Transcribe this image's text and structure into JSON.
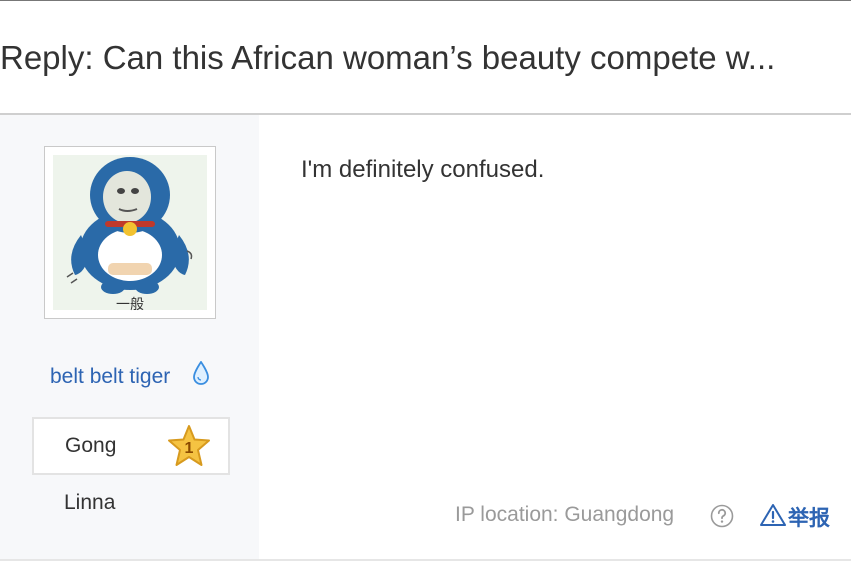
{
  "post": {
    "title": "Reply: Can this African woman’s beauty compete w...",
    "content": "I'm definitely confused."
  },
  "author": {
    "avatar_caption": "一般",
    "username": "belt belt tiger",
    "username_icon": "water-drop-icon",
    "level_name": "Gong",
    "level_number": "1",
    "level_icon": "star-badge-icon",
    "sub_name": "Linna"
  },
  "footer": {
    "ip_location": "IP location: Guangdong",
    "help_icon": "question-circle-icon",
    "report_label": "举报",
    "report_icon": "warning-triangle-icon"
  },
  "colors": {
    "link": "#2d64b3",
    "muted": "#9a9a9a",
    "sidebar_bg": "#f7f8fa",
    "star": "#f5c342"
  }
}
